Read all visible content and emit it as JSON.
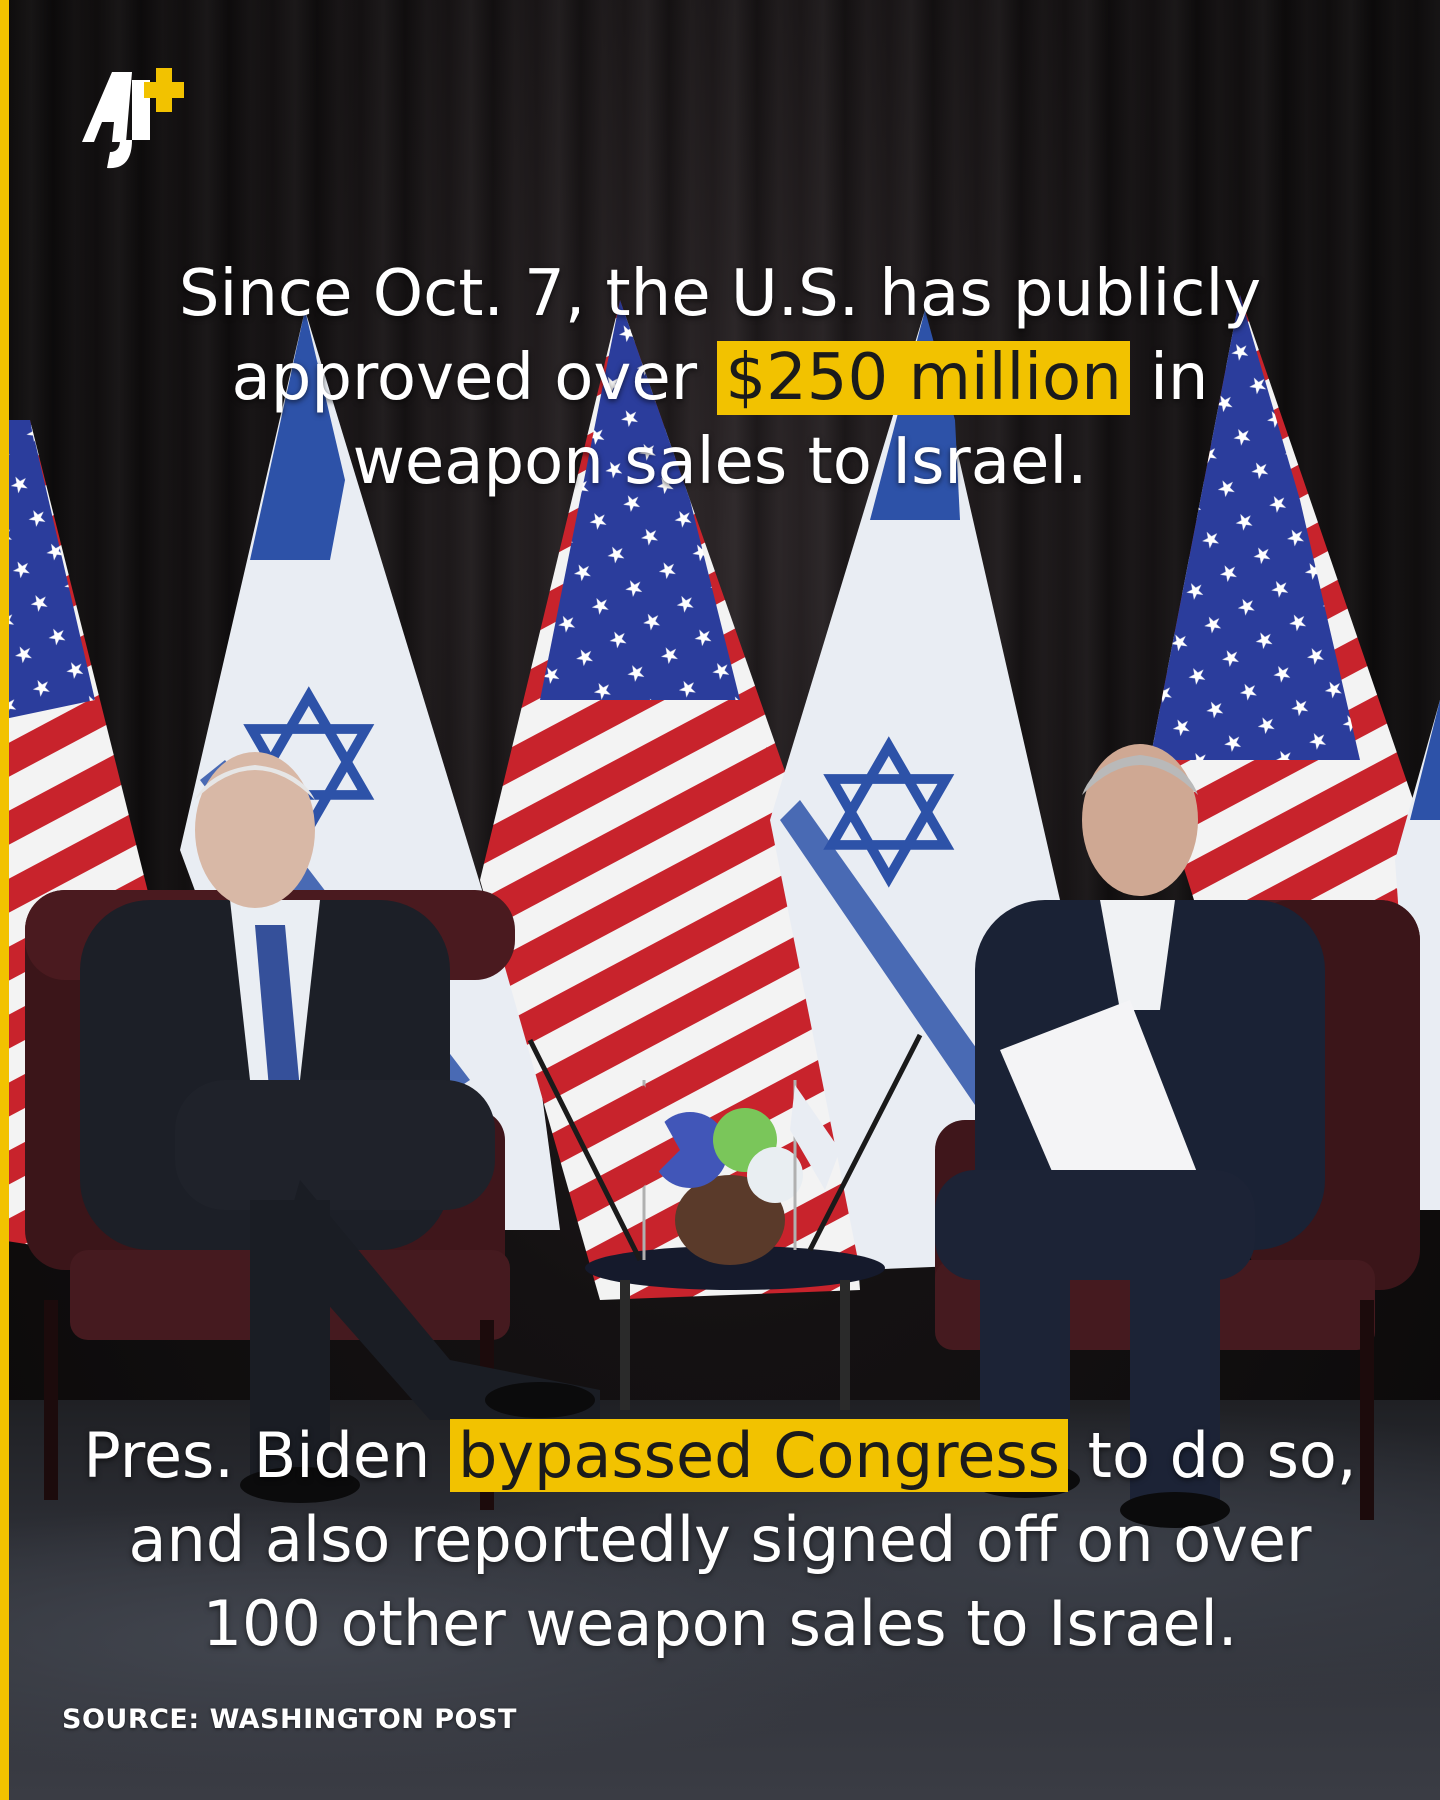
{
  "brand": {
    "logo": "AJ+",
    "accent_color": "#f2c200"
  },
  "headline": {
    "before": "Since Oct. 7, the U.S. has publicly approved over ",
    "highlight": "$250 million",
    "after": " in weapon sales to Israel."
  },
  "caption": {
    "before": "Pres. Biden ",
    "highlight": "bypassed Congress",
    "after": " to do so, and also reportedly signed off on over 100 other weapon sales to Israel."
  },
  "source": "SOURCE: WASHINGTON POST",
  "photo": {
    "subject": "two-men-seated-in-leather-armchairs-before-us-and-israeli-flags"
  }
}
